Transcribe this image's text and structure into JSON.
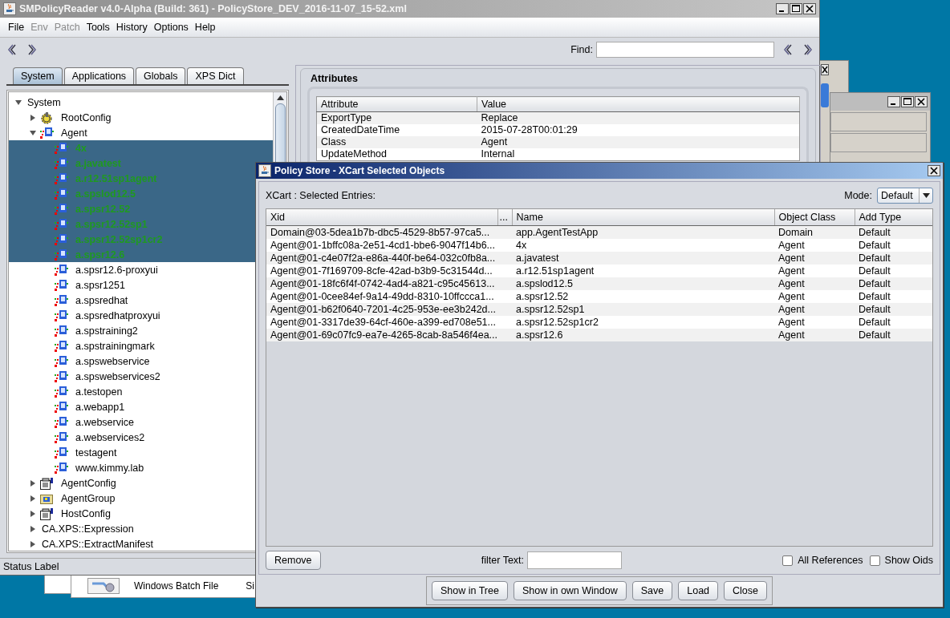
{
  "main_window": {
    "title": "SMPolicyReader v4.0-Alpha (Build: 361) - PolicyStore_DEV_2016-11-07_15-52.xml",
    "menu": [
      {
        "label": "File",
        "disabled": false
      },
      {
        "label": "Env",
        "disabled": true
      },
      {
        "label": "Patch",
        "disabled": true
      },
      {
        "label": "Tools",
        "disabled": false
      },
      {
        "label": "History",
        "disabled": false
      },
      {
        "label": "Options",
        "disabled": false
      },
      {
        "label": "Help",
        "disabled": false
      }
    ],
    "find": {
      "label": "Find:"
    },
    "tabs": [
      {
        "label": "System",
        "selected": true
      },
      {
        "label": "Applications",
        "selected": false
      },
      {
        "label": "Globals",
        "selected": false
      },
      {
        "label": "XPS Dict",
        "selected": false
      }
    ],
    "tree": [
      {
        "label": "System",
        "expanded": true,
        "selected": false,
        "children": [
          {
            "label": "RootConfig",
            "kind": "gear",
            "expanded": false,
            "selected": false
          },
          {
            "label": "Agent",
            "kind": "agent",
            "expanded": true,
            "selected": false,
            "children": [
              {
                "label": "4x",
                "kind": "agent",
                "selected": true
              },
              {
                "label": "a.javatest",
                "kind": "agent",
                "selected": true
              },
              {
                "label": "a.r12.51sp1agent",
                "kind": "agent",
                "selected": true
              },
              {
                "label": "a.spslod12.5",
                "kind": "agent",
                "selected": true
              },
              {
                "label": "a.spsr12.52",
                "kind": "agent",
                "selected": true
              },
              {
                "label": "a.spsr12.52sp1",
                "kind": "agent",
                "selected": true
              },
              {
                "label": "a.spsr12.52sp1cr2",
                "kind": "agent",
                "selected": true
              },
              {
                "label": "a.spsr12.6",
                "kind": "agent",
                "selected": true
              },
              {
                "label": "a.spsr12.6-proxyui",
                "kind": "agent",
                "selected": false
              },
              {
                "label": "a.spsr1251",
                "kind": "agent",
                "selected": false
              },
              {
                "label": "a.spsredhat",
                "kind": "agent",
                "selected": false
              },
              {
                "label": "a.spsredhatproxyui",
                "kind": "agent",
                "selected": false
              },
              {
                "label": "a.spstraining2",
                "kind": "agent",
                "selected": false
              },
              {
                "label": "a.spstrainingmark",
                "kind": "agent",
                "selected": false
              },
              {
                "label": "a.spswebservice",
                "kind": "agent",
                "selected": false
              },
              {
                "label": "a.spswebservices2",
                "kind": "agent",
                "selected": false
              },
              {
                "label": "a.testopen",
                "kind": "agent",
                "selected": false
              },
              {
                "label": "a.webapp1",
                "kind": "agent",
                "selected": false
              },
              {
                "label": "a.webservice",
                "kind": "agent",
                "selected": false
              },
              {
                "label": "a.webservices2",
                "kind": "agent",
                "selected": false
              },
              {
                "label": "testagent",
                "kind": "agent",
                "selected": false
              },
              {
                "label": "www.kimmy.lab",
                "kind": "agent",
                "selected": false
              }
            ]
          },
          {
            "label": "AgentConfig",
            "kind": "config",
            "expanded": false,
            "selected": false
          },
          {
            "label": "AgentGroup",
            "kind": "group",
            "expanded": false,
            "selected": false
          },
          {
            "label": "HostConfig",
            "kind": "config",
            "expanded": false,
            "selected": false
          },
          {
            "label": "CA.XPS::Expression",
            "expanded": false,
            "selected": false
          },
          {
            "label": "CA.XPS::ExtractManifest",
            "expanded": false,
            "selected": false
          }
        ]
      }
    ],
    "attributes": {
      "title": "Attributes",
      "columns": [
        "Attribute",
        "Value"
      ],
      "rows": [
        [
          "ExportType",
          "Replace"
        ],
        [
          "CreatedDateTime",
          "2015-07-28T00:01:29"
        ],
        [
          "Class",
          "Agent"
        ],
        [
          "UpdateMethod",
          "Internal"
        ]
      ]
    },
    "status_bar": "Status Label"
  },
  "background_window": {
    "file_type": "Windows Batch File",
    "column_2": "Si"
  },
  "dialog": {
    "title": "Policy Store - XCart Selected Objects",
    "heading": "XCart : Selected Entries:",
    "mode_label": "Mode:",
    "mode_value": "Default",
    "columns": [
      "Xid",
      "...",
      "Name",
      "Object Class",
      "Add Type"
    ],
    "rows": [
      {
        "xid": "Domain@03-5dea1b7b-dbc5-4529-8b57-97ca5...",
        "name": "app.AgentTestApp",
        "object_class": "Domain",
        "add_type": "Default"
      },
      {
        "xid": "Agent@01-1bffc08a-2e51-4cd1-bbe6-9047f14b6...",
        "name": "4x",
        "object_class": "Agent",
        "add_type": "Default"
      },
      {
        "xid": "Agent@01-c4e07f2a-e86a-440f-be64-032c0fb8a...",
        "name": "a.javatest",
        "object_class": "Agent",
        "add_type": "Default"
      },
      {
        "xid": "Agent@01-7f169709-8cfe-42ad-b3b9-5c31544d...",
        "name": "a.r12.51sp1agent",
        "object_class": "Agent",
        "add_type": "Default"
      },
      {
        "xid": "Agent@01-18fc6f4f-0742-4ad4-a821-c95c45613...",
        "name": "a.spslod12.5",
        "object_class": "Agent",
        "add_type": "Default"
      },
      {
        "xid": "Agent@01-0cee84ef-9a14-49dd-8310-10ffccca1...",
        "name": "a.spsr12.52",
        "object_class": "Agent",
        "add_type": "Default"
      },
      {
        "xid": "Agent@01-b62f0640-7201-4c25-953e-ee3b242d...",
        "name": "a.spsr12.52sp1",
        "object_class": "Agent",
        "add_type": "Default"
      },
      {
        "xid": "Agent@01-3317de39-64cf-460e-a399-ed708e51...",
        "name": "a.spsr12.52sp1cr2",
        "object_class": "Agent",
        "add_type": "Default"
      },
      {
        "xid": "Agent@01-69c07fc9-ea7e-4265-8cab-8a546f4ea...",
        "name": "a.spsr12.6",
        "object_class": "Agent",
        "add_type": "Default"
      }
    ],
    "remove_button": "Remove",
    "filter_label": "filter Text:",
    "checkboxes": [
      {
        "label": "All References",
        "checked": false
      },
      {
        "label": "Show Oids",
        "checked": false
      }
    ],
    "buttons": [
      "Show in Tree",
      "Show in own Window",
      "Save",
      "Load",
      "Close"
    ]
  }
}
